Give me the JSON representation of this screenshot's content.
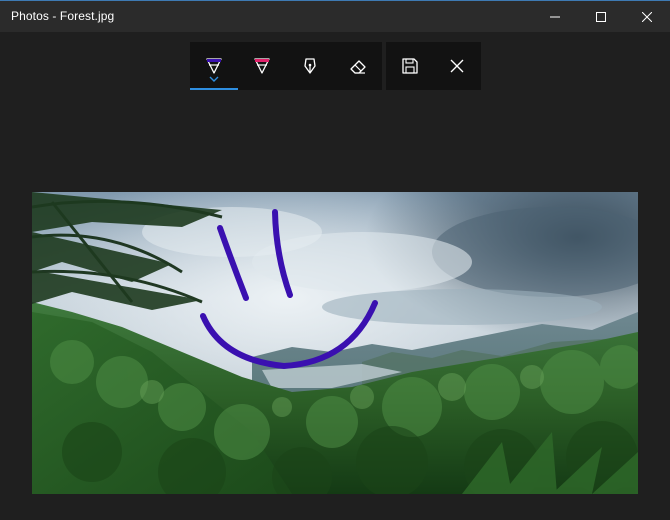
{
  "window": {
    "title": "Photos - Forest.jpg",
    "controls": {
      "minimize": "minimize-icon",
      "maximize": "maximize-icon",
      "close": "close-icon"
    }
  },
  "toolbar": {
    "pens": [
      {
        "id": "ballpoint-pen",
        "icon": "ballpoint-pen-icon",
        "selected": true,
        "ink_color": "#3a10b0"
      },
      {
        "id": "pencil",
        "icon": "pencil-icon",
        "selected": false,
        "ink_color": "#e0206a"
      },
      {
        "id": "calligraphy-pen",
        "icon": "calligraphy-pen-icon",
        "selected": false
      },
      {
        "id": "eraser",
        "icon": "eraser-icon",
        "selected": false
      }
    ],
    "actions": [
      {
        "id": "save",
        "icon": "save-icon"
      },
      {
        "id": "close",
        "icon": "close-icon"
      }
    ],
    "selection_color": "#2e8ee0"
  },
  "canvas": {
    "image": "forest-photo",
    "ink_color": "#3a10b0"
  }
}
